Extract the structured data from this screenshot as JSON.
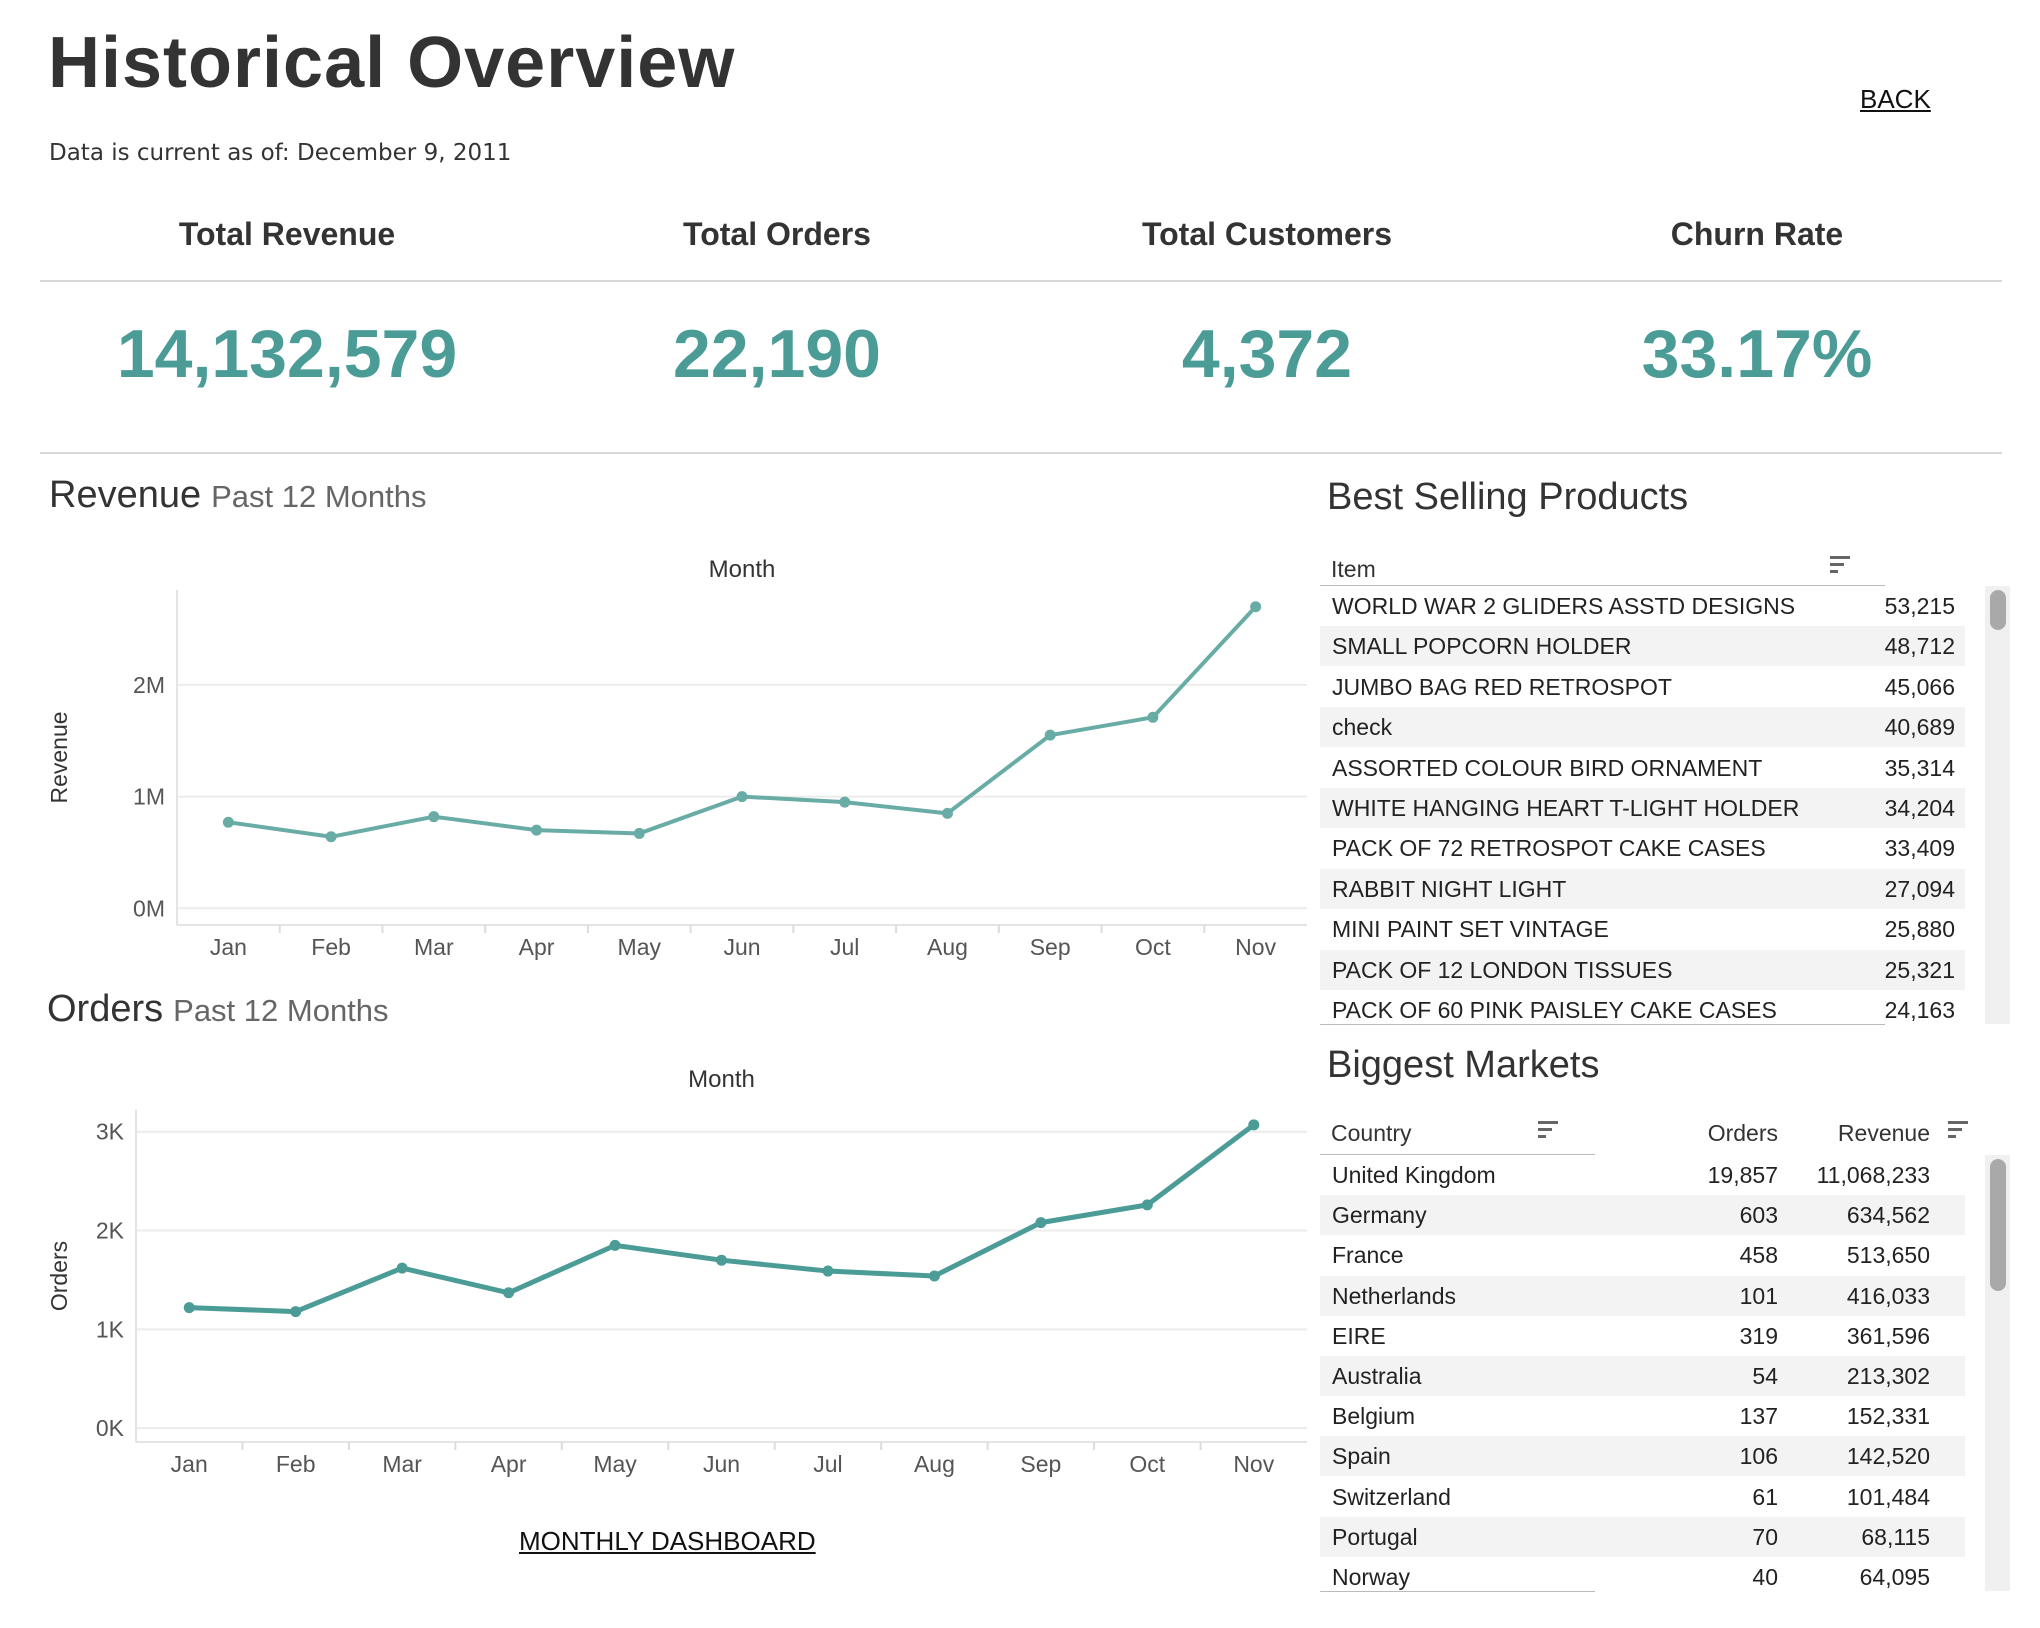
{
  "header": {
    "title": "Historical Overview",
    "back_label": "BACK",
    "as_of": "Data is current as of: December 9, 2011"
  },
  "kpis": [
    {
      "label": "Total Revenue",
      "value": "14,132,579"
    },
    {
      "label": "Total Orders",
      "value": "22,190"
    },
    {
      "label": "Total Customers",
      "value": "4,372"
    },
    {
      "label": "Churn Rate",
      "value": "33.17%"
    }
  ],
  "revenue_section": {
    "title": "Revenue",
    "subtitle": "Past 12 Months"
  },
  "orders_section": {
    "title": "Orders",
    "subtitle": "Past 12 Months"
  },
  "monthly_link": "MONTHLY DASHBOARD",
  "colors": {
    "accent": "#4b9c97",
    "revenue_line": "#69aca6",
    "orders_line": "#4b9c97"
  },
  "chart_data": [
    {
      "type": "line",
      "title": "",
      "xlabel": "Month",
      "ylabel": "Revenue",
      "categories": [
        "Jan",
        "Feb",
        "Mar",
        "Apr",
        "May",
        "Jun",
        "Jul",
        "Aug",
        "Sep",
        "Oct",
        "Nov"
      ],
      "values": [
        770000,
        640000,
        820000,
        700000,
        670000,
        1000000,
        950000,
        850000,
        1550000,
        1710000,
        2700000
      ],
      "ylim": [
        -150000,
        2850000
      ],
      "yticks": [
        0,
        1000000,
        2000000
      ],
      "ytick_labels": [
        "0M",
        "1M",
        "2M"
      ],
      "grid": true
    },
    {
      "type": "line",
      "title": "",
      "xlabel": "Month",
      "ylabel": "Orders",
      "categories": [
        "Jan",
        "Feb",
        "Mar",
        "Apr",
        "May",
        "Jun",
        "Jul",
        "Aug",
        "Sep",
        "Oct",
        "Nov"
      ],
      "values": [
        1220,
        1180,
        1620,
        1370,
        1850,
        1700,
        1590,
        1540,
        2080,
        2260,
        3070
      ],
      "ylim": [
        -140,
        3220
      ],
      "yticks": [
        0,
        1000,
        2000,
        3000
      ],
      "ytick_labels": [
        "0K",
        "1K",
        "2K",
        "3K"
      ],
      "grid": true
    }
  ],
  "best_selling": {
    "title": "Best Selling Products",
    "column_item": "Item",
    "rows": [
      {
        "item": "WORLD WAR 2 GLIDERS ASSTD DESIGNS",
        "qty": "53,215"
      },
      {
        "item": "SMALL POPCORN HOLDER",
        "qty": "48,712"
      },
      {
        "item": "JUMBO BAG RED RETROSPOT",
        "qty": "45,066"
      },
      {
        "item": "check",
        "qty": "40,689"
      },
      {
        "item": "ASSORTED COLOUR BIRD ORNAMENT",
        "qty": "35,314"
      },
      {
        "item": "WHITE HANGING HEART T-LIGHT HOLDER",
        "qty": "34,204"
      },
      {
        "item": "PACK OF 72 RETROSPOT CAKE CASES",
        "qty": "33,409"
      },
      {
        "item": "RABBIT NIGHT LIGHT",
        "qty": "27,094"
      },
      {
        "item": "MINI PAINT SET VINTAGE",
        "qty": "25,880"
      },
      {
        "item": "PACK OF 12 LONDON TISSUES",
        "qty": "25,321"
      },
      {
        "item": "PACK OF 60 PINK PAISLEY CAKE CASES",
        "qty": "24,163"
      }
    ]
  },
  "markets": {
    "title": "Biggest Markets",
    "column_country": "Country",
    "column_orders": "Orders",
    "column_revenue": "Revenue",
    "rows": [
      {
        "country": "United Kingdom",
        "orders": "19,857",
        "revenue": "11,068,233"
      },
      {
        "country": "Germany",
        "orders": "603",
        "revenue": "634,562"
      },
      {
        "country": "France",
        "orders": "458",
        "revenue": "513,650"
      },
      {
        "country": "Netherlands",
        "orders": "101",
        "revenue": "416,033"
      },
      {
        "country": "EIRE",
        "orders": "319",
        "revenue": "361,596"
      },
      {
        "country": "Australia",
        "orders": "54",
        "revenue": "213,302"
      },
      {
        "country": "Belgium",
        "orders": "137",
        "revenue": "152,331"
      },
      {
        "country": "Spain",
        "orders": "106",
        "revenue": "142,520"
      },
      {
        "country": "Switzerland",
        "orders": "61",
        "revenue": "101,484"
      },
      {
        "country": "Portugal",
        "orders": "70",
        "revenue": "68,115"
      },
      {
        "country": "Norway",
        "orders": "40",
        "revenue": "64,095"
      }
    ]
  }
}
